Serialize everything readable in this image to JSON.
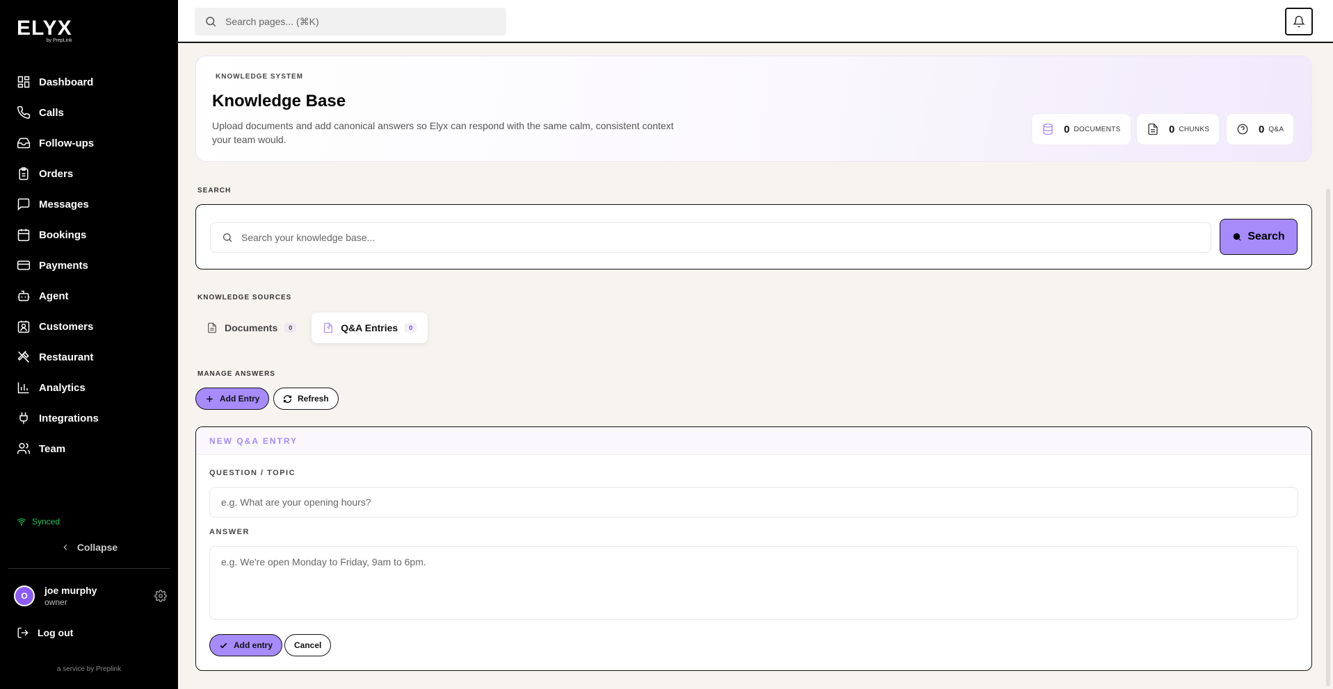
{
  "sidebar": {
    "logo": "ELYX",
    "logo_sub": "by PrepLink",
    "items": [
      {
        "label": "Dashboard",
        "icon": "dashboard-icon"
      },
      {
        "label": "Calls",
        "icon": "phone-icon"
      },
      {
        "label": "Follow-ups",
        "icon": "inbox-icon"
      },
      {
        "label": "Orders",
        "icon": "clipboard-icon"
      },
      {
        "label": "Messages",
        "icon": "message-icon"
      },
      {
        "label": "Bookings",
        "icon": "calendar-icon"
      },
      {
        "label": "Payments",
        "icon": "credit-card-icon"
      },
      {
        "label": "Agent",
        "icon": "bot-icon"
      },
      {
        "label": "Customers",
        "icon": "contact-icon"
      },
      {
        "label": "Restaurant",
        "icon": "utensils-icon"
      },
      {
        "label": "Analytics",
        "icon": "bar-chart-icon"
      },
      {
        "label": "Integrations",
        "icon": "plug-icon"
      },
      {
        "label": "Team",
        "icon": "users-icon"
      }
    ],
    "synced": "Synced",
    "collapse": "Collapse",
    "user": {
      "initial": "O",
      "name": "joe murphy",
      "role": "owner"
    },
    "logout": "Log out",
    "service": "a service by Preplink"
  },
  "header": {
    "search_placeholder": "Search pages... (⌘K)"
  },
  "hero": {
    "eyebrow": "KNOWLEDGE SYSTEM",
    "title": "Knowledge Base",
    "description": "Upload documents and add canonical answers so Elyx can respond with the same calm, consistent context your team would.",
    "stats": [
      {
        "value": "0",
        "label": "DOCUMENTS",
        "icon": "database-icon"
      },
      {
        "value": "0",
        "label": "CHUNKS",
        "icon": "file-text-icon"
      },
      {
        "value": "0",
        "label": "Q&A",
        "icon": "help-circle-icon"
      }
    ]
  },
  "search": {
    "section": "SEARCH",
    "placeholder": "Search your knowledge base...",
    "button": "Search"
  },
  "sources": {
    "section": "KNOWLEDGE SOURCES",
    "tabs": [
      {
        "label": "Documents",
        "count": "0"
      },
      {
        "label": "Q&A Entries",
        "count": "0"
      }
    ]
  },
  "manage": {
    "section": "MANAGE ANSWERS",
    "add_entry": "Add Entry",
    "refresh": "Refresh"
  },
  "form": {
    "title": "NEW Q&A ENTRY",
    "question_label": "QUESTION / TOPIC",
    "question_placeholder": "e.g. What are your opening hours?",
    "answer_label": "ANSWER",
    "answer_placeholder": "e.g. We're open Monday to Friday, 9am to 6pm.",
    "submit": "Add entry",
    "cancel": "Cancel"
  },
  "colors": {
    "accent": "#a78bfa",
    "sidebar_bg": "#000000",
    "page_bg": "#f7f3ee",
    "synced": "#22c55e"
  }
}
